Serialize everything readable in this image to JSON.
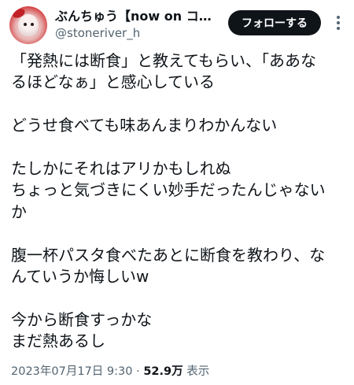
{
  "author": {
    "display_name": "ぶんちゅう【now on コ…",
    "handle": "@stoneriver_h",
    "follow_label": "フォローする"
  },
  "tweet": {
    "lines": [
      "「発熱には断食」と教えてもらい、「ああな",
      "るほどなぁ」と感心している",
      "",
      "どうせ食べても味あんまりわかんない",
      "",
      "たしかにそれはアリかもしれぬ",
      "ちょっと気づきにくい妙手だったんじゃない",
      "か",
      "",
      "腹一杯パスタ食べたあとに断食を教わり、な",
      "んていうか悔しいw",
      "",
      "今から断食すっかな",
      "まだ熱あるし"
    ]
  },
  "meta": {
    "timestamp": "2023年07月17日 9:30",
    "separator": "·",
    "views": "52.9万",
    "views_label": "表示"
  },
  "icons": {
    "avatar": "avatar-image",
    "more": "more-options-icon"
  }
}
